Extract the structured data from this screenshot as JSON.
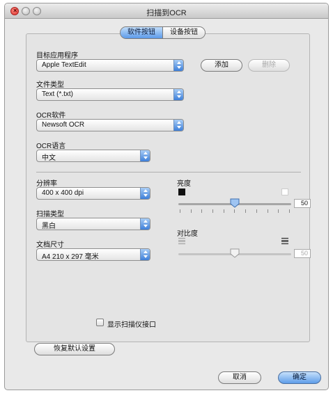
{
  "window": {
    "title": "扫描到OCR"
  },
  "tabs": [
    {
      "label": "软件按钮",
      "active": true
    },
    {
      "label": "设备按钮",
      "active": false
    }
  ],
  "app_section": {
    "target_app_label": "目标应用程序",
    "target_app_value": "Apple TextEdit",
    "add_button": "添加",
    "delete_button": "删除",
    "file_type_label": "文件类型",
    "file_type_value": "Text (*.txt)",
    "ocr_software_label": "OCR软件",
    "ocr_software_value": "Newsoft OCR",
    "ocr_language_label": "OCR语言",
    "ocr_language_value": "中文"
  },
  "scan_section": {
    "resolution_label": "分辨率",
    "resolution_value": "400 x 400 dpi",
    "scan_type_label": "扫描类型",
    "scan_type_value": "黑白",
    "document_size_label": "文档尺寸",
    "document_size_value": "A4 210 x 297 毫米",
    "brightness_label": "亮度",
    "brightness_value": "50",
    "contrast_label": "对比度",
    "contrast_value": "50",
    "show_scanner_interface_label": "显示扫描仪接口",
    "show_scanner_interface_checked": false
  },
  "buttons": {
    "restore_defaults": "恢复默认设置",
    "cancel": "取消",
    "ok": "确定"
  },
  "colors": {
    "accent_blue": "#5d9bea",
    "window_bg": "#e9e9e9",
    "close_red": "#d9302a"
  }
}
